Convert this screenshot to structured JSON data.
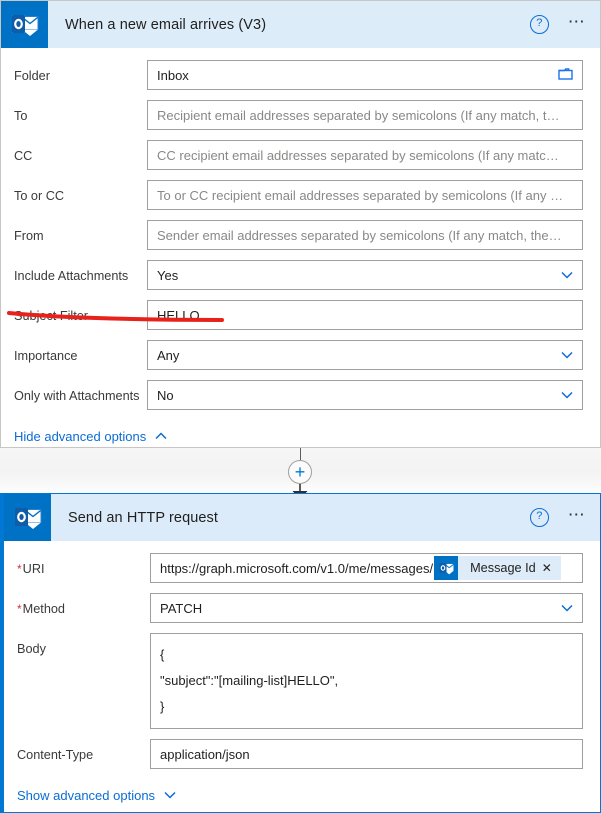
{
  "cards": [
    {
      "id": "trigger",
      "title": "When a new email arrives (V3)",
      "icon": "outlook-icon",
      "help_icon": "help-icon",
      "more_icon": "ellipsis-icon",
      "selected": false,
      "fields": [
        {
          "name": "folder",
          "label": "Folder",
          "required": false,
          "type": "text-with-picker",
          "value": "Inbox",
          "placeholder": "",
          "trailing_icon": "folder-icon"
        },
        {
          "name": "to",
          "label": "To",
          "required": false,
          "type": "text",
          "value": "",
          "placeholder": "Recipient email addresses separated by semicolons (If any match, t…"
        },
        {
          "name": "cc",
          "label": "CC",
          "required": false,
          "type": "text",
          "value": "",
          "placeholder": "CC recipient email addresses separated by semicolons (If any matc…"
        },
        {
          "name": "to-or-cc",
          "label": "To or CC",
          "required": false,
          "type": "text",
          "value": "",
          "placeholder": "To or CC recipient email addresses separated by semicolons (If any …"
        },
        {
          "name": "from",
          "label": "From",
          "required": false,
          "type": "text",
          "value": "",
          "placeholder": "Sender email addresses separated by semicolons (If any match, the…"
        },
        {
          "name": "include-attachments",
          "label": "Include Attachments",
          "required": false,
          "type": "dropdown",
          "value": "Yes",
          "placeholder": "",
          "trailing_icon": "chevron-down-icon"
        },
        {
          "name": "subject-filter",
          "label": "Subject Filter",
          "required": false,
          "type": "text",
          "value": "HELLO",
          "placeholder": ""
        },
        {
          "name": "importance",
          "label": "Importance",
          "required": false,
          "type": "dropdown",
          "value": "Any",
          "placeholder": "",
          "trailing_icon": "chevron-down-icon"
        },
        {
          "name": "only-with-attachments",
          "label": "Only with Attachments",
          "required": false,
          "type": "dropdown",
          "value": "No",
          "placeholder": "",
          "trailing_icon": "chevron-down-icon"
        }
      ],
      "advanced_link": {
        "label": "Hide advanced options",
        "icon": "chevron-up-icon"
      }
    },
    {
      "id": "action",
      "title": "Send an HTTP request",
      "icon": "outlook-icon",
      "help_icon": "help-icon",
      "more_icon": "ellipsis-icon",
      "selected": true,
      "fields": [
        {
          "name": "uri",
          "label": "URI",
          "required": true,
          "type": "text-with-token",
          "value": "https://graph.microsoft.com/v1.0/me/messages/",
          "placeholder": "",
          "token": {
            "label": "Message Id",
            "icon": "outlook-icon",
            "remove_icon": "close-icon"
          }
        },
        {
          "name": "method",
          "label": "Method",
          "required": true,
          "type": "dropdown",
          "value": "PATCH",
          "placeholder": "",
          "trailing_icon": "chevron-down-icon"
        },
        {
          "name": "body",
          "label": "Body",
          "required": false,
          "type": "textarea",
          "value": "{\n\"subject\":\"[mailing-list]HELLO\",\n}",
          "placeholder": ""
        },
        {
          "name": "content-type",
          "label": "Content-Type",
          "required": false,
          "type": "text",
          "value": "application/json",
          "placeholder": ""
        }
      ],
      "advanced_link": {
        "label": "Show advanced options",
        "icon": "chevron-down-icon"
      }
    }
  ],
  "connector": {
    "add_button_label": "+",
    "add_icon": "plus-circle-icon",
    "arrow_icon": "arrow-down-icon"
  },
  "annotations": [
    {
      "name": "subject-filter-underline",
      "shape": "line",
      "color": "#e8211b"
    }
  ],
  "colors": {
    "accent": "#0078d4",
    "header_bg": "#dcecf9",
    "app_icon_bg": "#0072c6",
    "required_marker": "#d13438",
    "annotation_red": "#e8211b",
    "link": "#0b6cd4"
  }
}
